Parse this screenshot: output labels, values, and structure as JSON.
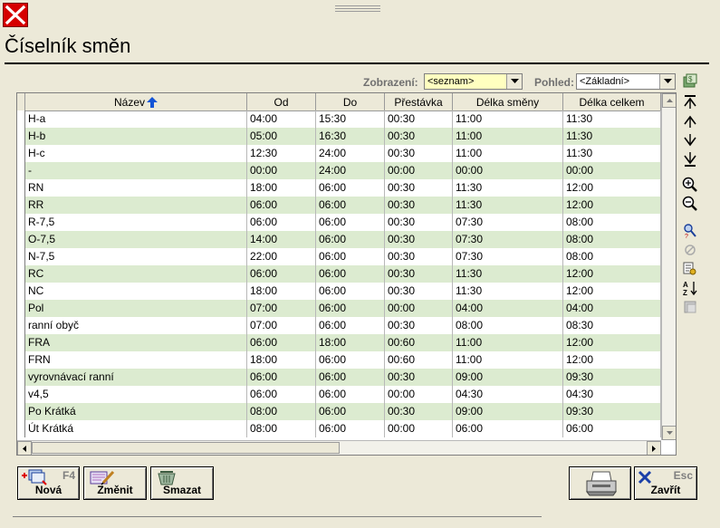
{
  "window": {
    "title": "Číselník směn"
  },
  "filters": {
    "view_label": "Zobrazení:",
    "view_value": "<seznam>",
    "layout_label": "Pohled:",
    "layout_value": "<Základní>"
  },
  "table": {
    "columns": [
      "Název",
      "Od",
      "Do",
      "Přestávka",
      "Délka směny",
      "Délka celkem"
    ],
    "sort_column": "Název",
    "rows": [
      [
        "H-a",
        "04:00",
        "15:30",
        "00:30",
        "11:00",
        "11:30"
      ],
      [
        "H-b",
        "05:00",
        "16:30",
        "00:30",
        "11:00",
        "11:30"
      ],
      [
        "H-c",
        "12:30",
        "24:00",
        "00:30",
        "11:00",
        "11:30"
      ],
      [
        "-",
        "00:00",
        "24:00",
        "00:00",
        "00:00",
        "00:00"
      ],
      [
        "RN",
        "18:00",
        "06:00",
        "00:30",
        "11:30",
        "12:00"
      ],
      [
        "RR",
        "06:00",
        "06:00",
        "00:30",
        "11:30",
        "12:00"
      ],
      [
        "R-7,5",
        "06:00",
        "06:00",
        "00:30",
        "07:30",
        "08:00"
      ],
      [
        "O-7,5",
        "14:00",
        "06:00",
        "00:30",
        "07:30",
        "08:00"
      ],
      [
        "N-7,5",
        "22:00",
        "06:00",
        "00:30",
        "07:30",
        "08:00"
      ],
      [
        "RC",
        "06:00",
        "06:00",
        "00:30",
        "11:30",
        "12:00"
      ],
      [
        "NC",
        "18:00",
        "06:00",
        "00:30",
        "11:30",
        "12:00"
      ],
      [
        "Pol",
        "07:00",
        "06:00",
        "00:00",
        "04:00",
        "04:00"
      ],
      [
        "ranní obyč",
        "07:00",
        "06:00",
        "00:30",
        "08:00",
        "08:30"
      ],
      [
        "FRA",
        "06:00",
        "18:00",
        "00:60",
        "11:00",
        "12:00"
      ],
      [
        "FRN",
        "18:00",
        "06:00",
        "00:60",
        "11:00",
        "12:00"
      ],
      [
        "vyrovnávací ranní",
        "06:00",
        "06:00",
        "00:30",
        "09:00",
        "09:30"
      ],
      [
        "v4,5",
        "06:00",
        "06:00",
        "00:00",
        "04:30",
        "04:30"
      ],
      [
        "Po Krátká",
        "08:00",
        "06:00",
        "00:30",
        "09:00",
        "09:30"
      ],
      [
        "Út Krátká",
        "08:00",
        "06:00",
        "00:00",
        "06:00",
        "06:00"
      ]
    ]
  },
  "buttons": {
    "new_label": "Nová",
    "new_key": "F4",
    "edit_label": "Změnit",
    "delete_label": "Smazat",
    "close_label": "Zavřít",
    "close_key": "Esc"
  },
  "colors": {
    "alt_row": "#dcebd0",
    "view_combo_bg": "#ffffc0",
    "close_red": "#d60000"
  }
}
